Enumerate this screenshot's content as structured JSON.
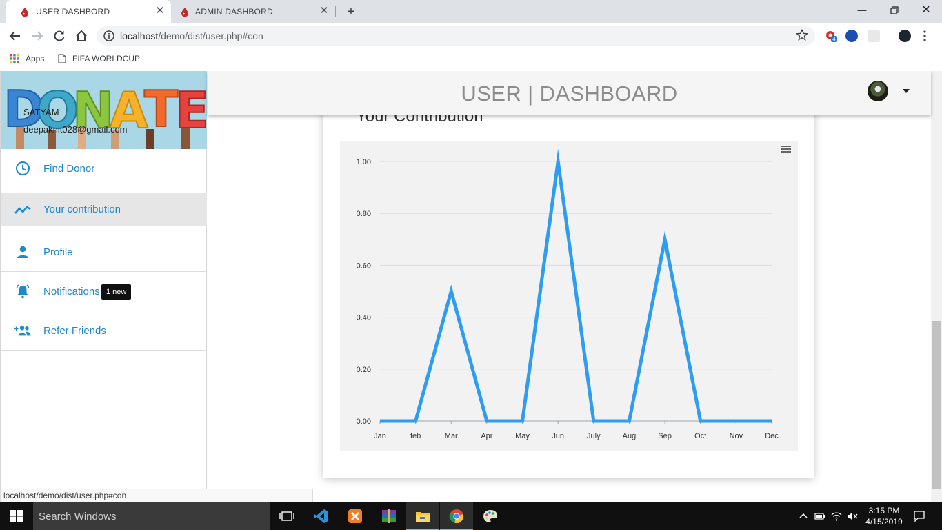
{
  "browser": {
    "tabs": [
      {
        "title": "USER DASHBORD",
        "active": true
      },
      {
        "title": "ADMIN DASHBORD",
        "active": false
      }
    ],
    "url_host": "localhost",
    "url_path": "/demo/dist/user.php#con",
    "extension_badge": "4",
    "bookmarks": [
      {
        "label": "Apps",
        "icon": "apps-grid-icon"
      },
      {
        "label": "FIFA WORLDCUP",
        "icon": "page-icon"
      }
    ],
    "status_url": "localhost/demo/dist/user.php#con"
  },
  "sidebar": {
    "banner_text": "DONATE",
    "user_name": "SATYAM",
    "user_email": "deepaknit028@gmail.com",
    "items": [
      {
        "label": "Find Donor",
        "icon": "clock-icon"
      },
      {
        "label": "Your contribution",
        "icon": "trending-line-icon",
        "active": true
      },
      {
        "label": "Profile",
        "icon": "person-icon"
      },
      {
        "label": "Notifications",
        "icon": "bell-icon",
        "badge": "1 new"
      },
      {
        "label": "Refer Friends",
        "icon": "add-group-icon"
      }
    ]
  },
  "header": {
    "title": "USER | DASHBOARD"
  },
  "card": {
    "title": "Your Contribution"
  },
  "chart_data": {
    "type": "line",
    "categories": [
      "Jan",
      "feb",
      "Mar",
      "Apr",
      "May",
      "Jun",
      "July",
      "Aug",
      "Sep",
      "Oct",
      "Nov",
      "Dec"
    ],
    "series": [
      {
        "values": [
          0,
          0,
          0.5,
          0,
          0,
          1.0,
          0,
          0,
          0.7,
          0,
          0,
          0
        ]
      }
    ],
    "y_ticks": [
      "0.00",
      "0.20",
      "0.40",
      "0.60",
      "0.80",
      "1.00"
    ],
    "ylim": [
      0,
      1.0
    ],
    "grid": true,
    "line_color": "#2e9cf0",
    "menu_icon": "hamburger-menu-icon"
  },
  "taskbar": {
    "search_placeholder": "Search Windows",
    "time": "3:15 PM",
    "date": "4/15/2019"
  },
  "colors": {
    "accent": "#1e88c8",
    "header_title": "#8c8c8c"
  }
}
